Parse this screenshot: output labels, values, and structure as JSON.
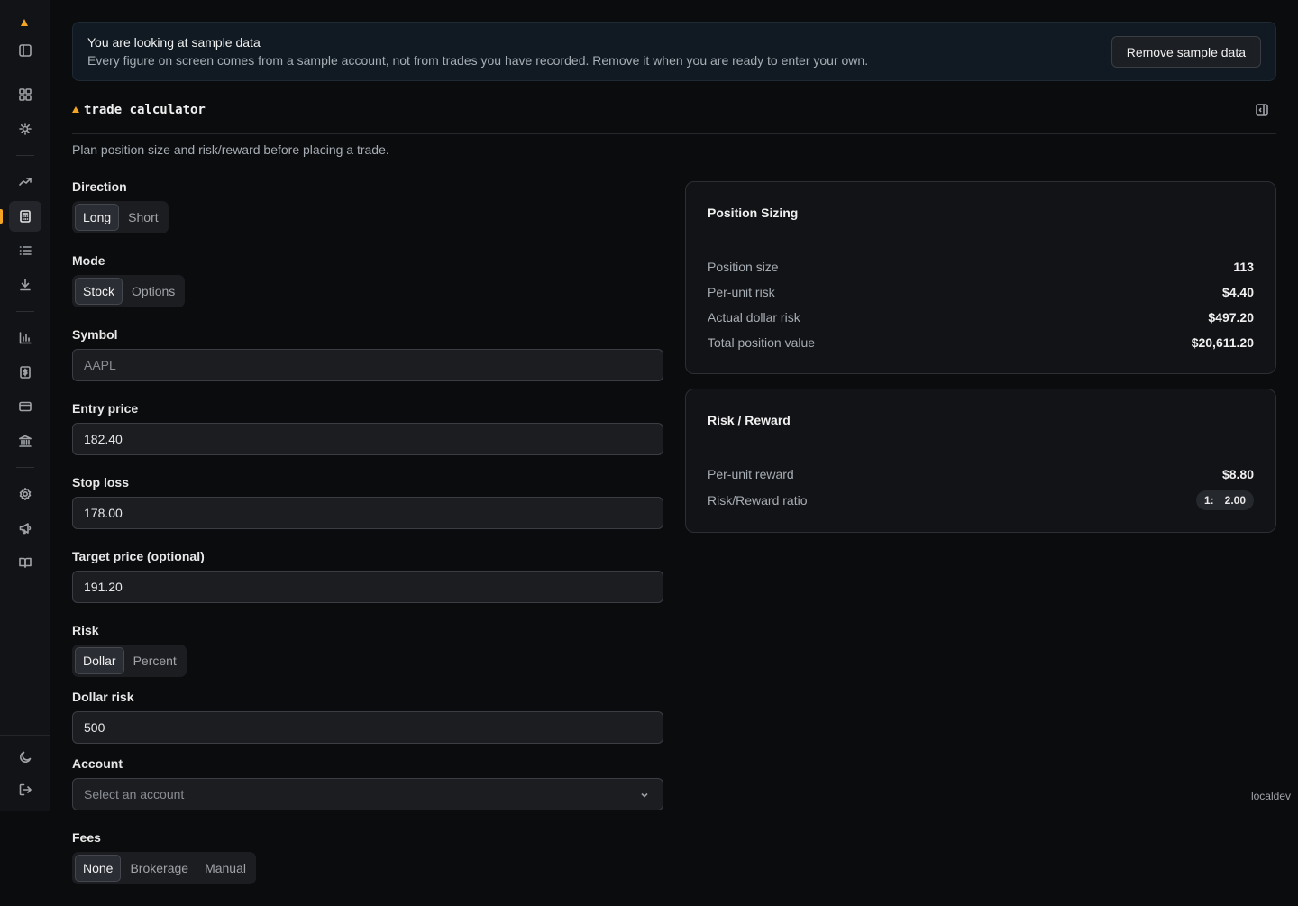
{
  "sidebar": {
    "icons": [
      "logo-icon",
      "panel-toggle-icon",
      "dashboard-icon",
      "integrations-icon",
      "trending-icon",
      "calculator-icon",
      "list-icon",
      "download-icon",
      "bar-chart-icon",
      "dollar-icon",
      "credit-card-icon",
      "bank-icon",
      "settings-icon",
      "megaphone-icon",
      "book-icon",
      "moon-icon",
      "logout-icon"
    ],
    "active": "calculator-icon"
  },
  "banner": {
    "title": "You are looking at sample data",
    "text": "Every figure on screen comes from a sample account, not from trades you have recorded. Remove it when you are ready to enter your own.",
    "button": "Remove sample data"
  },
  "header": {
    "title": "trade calculator",
    "subtitle": "Plan position size and risk/reward before placing a trade."
  },
  "form": {
    "direction": {
      "label": "Direction",
      "options": [
        "Long",
        "Short"
      ],
      "selected": "Long"
    },
    "mode": {
      "label": "Mode",
      "options": [
        "Stock",
        "Options"
      ],
      "selected": "Stock"
    },
    "symbol": {
      "label": "Symbol",
      "placeholder": "AAPL",
      "value": ""
    },
    "entry": {
      "label": "Entry price",
      "value": "182.40"
    },
    "stop": {
      "label": "Stop loss",
      "value": "178.00"
    },
    "target": {
      "label": "Target price (optional)",
      "value": "191.20"
    },
    "risk": {
      "label": "Risk",
      "options": [
        "Dollar",
        "Percent"
      ],
      "selected": "Dollar"
    },
    "dollar_risk": {
      "label": "Dollar risk",
      "value": "500"
    },
    "account": {
      "label": "Account",
      "placeholder": "Select an account"
    },
    "fees": {
      "label": "Fees",
      "options": [
        "None",
        "Brokerage",
        "Manual"
      ],
      "selected": "None"
    }
  },
  "position_sizing": {
    "title": "Position Sizing",
    "rows": [
      {
        "label": "Position size",
        "value": "113"
      },
      {
        "label": "Per-unit risk",
        "value": "$4.40"
      },
      {
        "label": "Actual dollar risk",
        "value": "$497.20"
      },
      {
        "label": "Total position value",
        "value": "$20,611.20"
      }
    ]
  },
  "risk_reward": {
    "title": "Risk / Reward",
    "per_unit_reward_label": "Per-unit reward",
    "per_unit_reward_value": "$8.80",
    "ratio_label": "Risk/Reward ratio",
    "ratio_left": "1:",
    "ratio_right": "2.00"
  },
  "footer": {
    "env": "localdev"
  },
  "colors": {
    "accent": "#f5a524",
    "background": "#0b0c0e"
  }
}
